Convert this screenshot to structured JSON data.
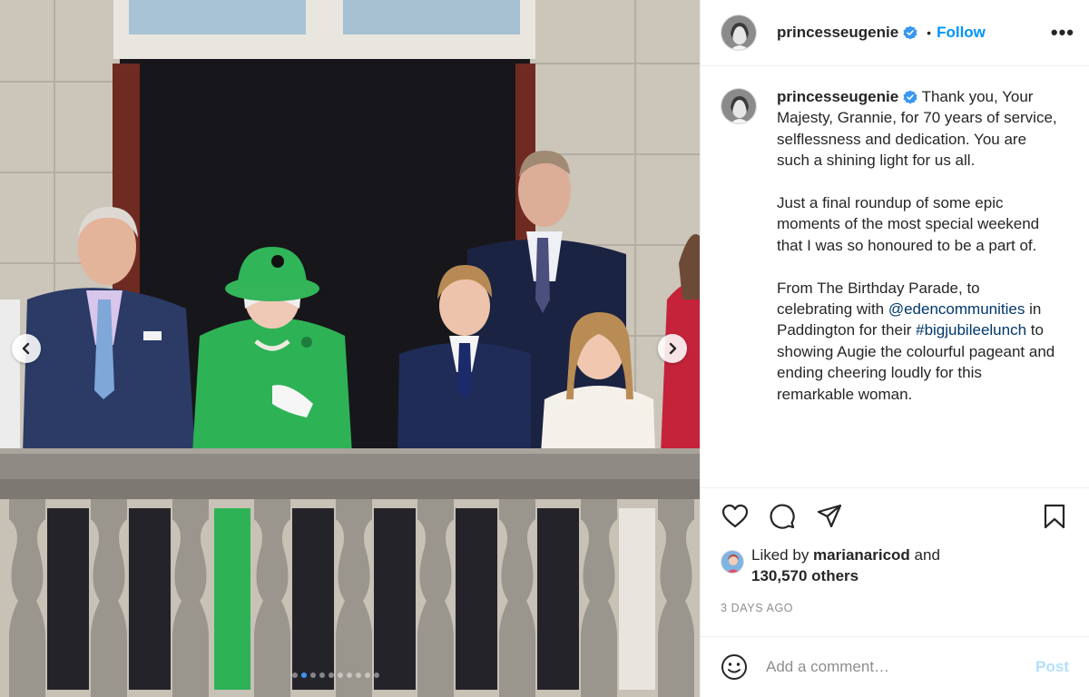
{
  "colors": {
    "accent": "#0095f6",
    "link": "#00376b",
    "muted": "#8e8e8e",
    "post_disabled": "#b2dffc"
  },
  "carousel": {
    "total_slides": 10,
    "active_slide": 2,
    "prev_icon": "chevron-left-icon",
    "next_icon": "chevron-right-icon"
  },
  "header": {
    "username": "princesseugenie",
    "verified": true,
    "bullet": "•",
    "follow_label": "Follow",
    "more_label": "•••"
  },
  "caption": {
    "username": "princesseugenie",
    "p1": "Thank you, Your Majesty, Grannie, for 70 years of service, selflessness and dedication. You are such a shining light for us all.",
    "p2": "Just a final roundup of some epic moments of the most special weekend that I was so honoured to be a part of.",
    "p3_a": "From The Birthday Parade, to celebrating with ",
    "p3_mention": "@edencommunities",
    "p3_b": " in Paddington for their ",
    "p3_hashtag": "#bigjubileelunch",
    "p3_c": " to showing Augie the colourful pageant and ending cheering loudly for this remarkable woman."
  },
  "actions": {
    "like_icon": "heart-icon",
    "comment_icon": "comment-bubble-icon",
    "share_icon": "paper-plane-icon",
    "save_icon": "bookmark-icon"
  },
  "likes": {
    "prefix": "Liked by ",
    "user": "marianaricod",
    "and": " and",
    "count": "130,570 others"
  },
  "timestamp": "3 DAYS AGO",
  "comment": {
    "placeholder": "Add a comment…",
    "post_label": "Post",
    "emoji_icon": "smiley-icon"
  }
}
